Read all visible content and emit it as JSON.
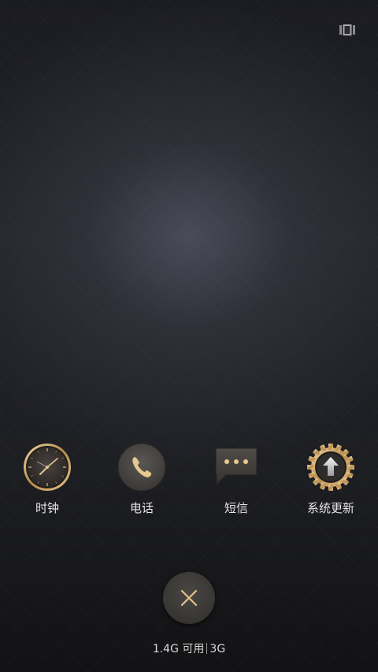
{
  "apps": [
    {
      "label": "时钟",
      "icon": "clock-icon"
    },
    {
      "label": "电话",
      "icon": "phone-icon"
    },
    {
      "label": "短信",
      "icon": "message-icon"
    },
    {
      "label": "系统更新",
      "icon": "system-update-icon"
    }
  ],
  "toolbar": {
    "multi_window_icon": "multi-window-icon",
    "close_icon": "close-icon"
  },
  "memory": {
    "available": "1.4G 可用",
    "total": "3G"
  },
  "colors": {
    "accent_gold": "#c9a56a",
    "label_text": "#e6e6e6"
  }
}
